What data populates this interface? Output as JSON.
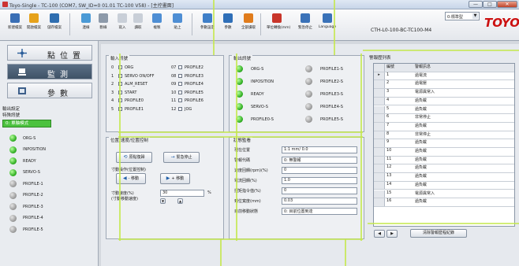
{
  "window": {
    "title": "Toyo-Single - TC-100 (COM7, SW_ID=0 01.01 TC-100 V58) - [主控畫面]",
    "minimize": "—",
    "maximize": "□",
    "close": "✕"
  },
  "toolbar": {
    "buttons": [
      {
        "label": "新建檔案",
        "icon": "new-file-icon",
        "color": "#3a6fb5"
      },
      {
        "label": "開啟檔案",
        "icon": "open-file-icon",
        "color": "#e6a21b"
      },
      {
        "label": "儲存檔案",
        "icon": "save-file-icon",
        "color": "#2f6eb0"
      },
      {
        "label": "連線",
        "icon": "connect-icon",
        "color": "#4b9ad6"
      },
      {
        "label": "斷線",
        "icon": "disconnect-icon",
        "color": "#8d9aaa"
      },
      {
        "label": "寫入",
        "icon": "write-icon",
        "color": "#c9cfd8"
      },
      {
        "label": "讀取",
        "icon": "read-icon",
        "color": "#c9cfd8"
      },
      {
        "label": "複製",
        "icon": "copy-icon",
        "color": "#4e8ed4"
      },
      {
        "label": "貼上",
        "icon": "paste-icon",
        "color": "#4e8ed4"
      },
      {
        "label": "參數設定",
        "icon": "params-icon",
        "color": "#3f7fc8"
      },
      {
        "label": "參數",
        "icon": "arrow-right-icon",
        "color": "#2f6fb8"
      },
      {
        "label": "全部讀取",
        "icon": "read-all-icon",
        "color": "#e07c1c"
      },
      {
        "label": "單位轉換(mm)",
        "icon": "unit-icon",
        "color": "#c8352a"
      },
      {
        "label": "緊急停止",
        "icon": "estop-icon",
        "color": "#3a72b8"
      },
      {
        "label": "Language",
        "icon": "language-icon",
        "color": "#3a72b8"
      }
    ],
    "model_select": "0:標準型",
    "model_code": "CTH-L0-100-BC-TC100-M4",
    "logo": "TOYO"
  },
  "sidebar": {
    "nav": [
      {
        "label": "點位置",
        "icon": "axis-cross-icon"
      },
      {
        "label": "監測",
        "icon": "monitor-icon"
      },
      {
        "label": "參數",
        "icon": "params-book-icon"
      }
    ],
    "signal_title": "輸出設定",
    "signal_subtitle": "特殊訊號",
    "axis_select": "0: 單軸模式",
    "signals": [
      {
        "label": "ORG-S",
        "state": "on"
      },
      {
        "label": "INPOSITION",
        "state": "on"
      },
      {
        "label": "READY",
        "state": "on"
      },
      {
        "label": "SERVO-S",
        "state": "on"
      },
      {
        "label": "PROFILE-1",
        "state": "off"
      },
      {
        "label": "PROFILE-2",
        "state": "off"
      },
      {
        "label": "PROFILE-3",
        "state": "off"
      },
      {
        "label": "PROFILE-4",
        "state": "off"
      },
      {
        "label": "PROFILE-5",
        "state": "off"
      }
    ]
  },
  "input_group": {
    "title": "輸入訊號",
    "col1": [
      {
        "num": "0",
        "label": "ORG"
      },
      {
        "num": "1",
        "label": "SERVO ON/OFF"
      },
      {
        "num": "2",
        "label": "ALM_RESET"
      },
      {
        "num": "3",
        "label": "START"
      },
      {
        "num": "4",
        "label": "PROFILE0"
      },
      {
        "num": "5",
        "label": "PROFILE1"
      }
    ],
    "col2": [
      {
        "num": "07",
        "label": "PROFILE2"
      },
      {
        "num": "08",
        "label": "PROFILE3"
      },
      {
        "num": "09",
        "label": "PROFILE4"
      },
      {
        "num": "10",
        "label": "PROFILE5"
      },
      {
        "num": "11",
        "label": "PROFILE6"
      },
      {
        "num": "12",
        "label": "JOG"
      }
    ]
  },
  "output_group": {
    "title": "輸出訊號",
    "col1": [
      {
        "label": "ORG-S",
        "state": "on"
      },
      {
        "label": "INPOSITION",
        "state": "on"
      },
      {
        "label": "READY",
        "state": "on"
      },
      {
        "label": "SERVO-S",
        "state": "on"
      },
      {
        "label": "PROFILE0-S",
        "state": "on"
      }
    ],
    "col2": [
      {
        "label": "PROFILE1-S",
        "state": "off"
      },
      {
        "label": "PROFILE2-S",
        "state": "off"
      },
      {
        "label": "PROFILE3-S",
        "state": "off"
      },
      {
        "label": "PROFILE4-S",
        "state": "off"
      },
      {
        "label": "PROFILE5-S",
        "state": "off"
      }
    ]
  },
  "jog_group": {
    "title": "位置/速度/位置控制",
    "home_btn": "原點復歸",
    "stop_btn": "緊急停止",
    "inch_title": "寸動操作(位置控制)",
    "minus_btn": "- 移動",
    "plus_btn": "+ 移動",
    "speed_label": "寸動速度(%)",
    "speed_sub": "(寸動移動速度)",
    "speed_value": "30",
    "unit": "%"
  },
  "status_group": {
    "title": "狀態監看",
    "rows": [
      {
        "label": "現在位置",
        "value": "1:1 mm/ 0.0"
      },
      {
        "label": "警報代碼",
        "value": "0: 無警報"
      },
      {
        "label": "速度回饋(rpm)(%)",
        "value": "0"
      },
      {
        "label": "電流回饋(%)",
        "value": "1.0"
      },
      {
        "label": "扭矩指令值(%)",
        "value": "0"
      },
      {
        "label": "到位寬度(mm)",
        "value": "0.03"
      },
      {
        "label": "目前移動狀態",
        "value": "0: 目前位置到達"
      }
    ]
  },
  "alarm_list": {
    "title": "警報歷列表",
    "headers": [
      "編號",
      "警報訊息"
    ],
    "rows": [
      {
        "no": "1",
        "msg": "過電流"
      },
      {
        "no": "2",
        "msg": "過電壓"
      },
      {
        "no": "3",
        "msg": "電源異常入"
      },
      {
        "no": "4",
        "msg": "過負載"
      },
      {
        "no": "5",
        "msg": "過負載"
      },
      {
        "no": "6",
        "msg": "非常停止"
      },
      {
        "no": "7",
        "msg": "過負載"
      },
      {
        "no": "8",
        "msg": "非常停止"
      },
      {
        "no": "9",
        "msg": "過負載"
      },
      {
        "no": "10",
        "msg": "過負載"
      },
      {
        "no": "11",
        "msg": "過負載"
      },
      {
        "no": "12",
        "msg": "過負載"
      },
      {
        "no": "13",
        "msg": "過負載"
      },
      {
        "no": "14",
        "msg": "過負載"
      },
      {
        "no": "15",
        "msg": "電源異常入"
      },
      {
        "no": "16",
        "msg": "過負載"
      }
    ],
    "prev_label": "◀",
    "next_label": "▶",
    "clear_btn": "清除警報歷程紀錄"
  }
}
